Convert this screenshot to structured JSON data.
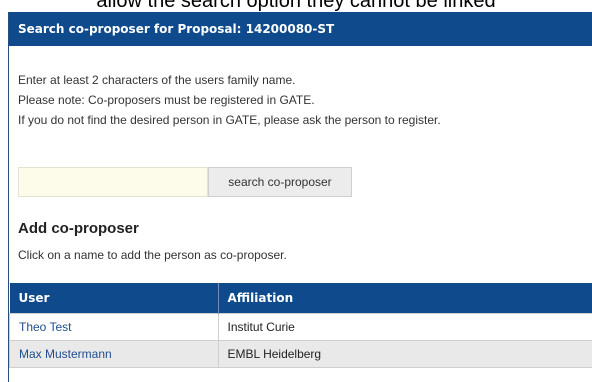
{
  "caption": "allow the search option they cannot be linked",
  "header": {
    "title": "Search co-proposer for Proposal: 14200080-ST"
  },
  "info": {
    "line1": "Enter at least 2 characters of the users family name.",
    "line2": "Please note: Co-proposers must be registered in GATE.",
    "line3": "If you do not find the desired person in GATE, please ask the person to register."
  },
  "search": {
    "value": "",
    "button_label": "search co-proposer"
  },
  "add_section": {
    "title": "Add co-proposer",
    "description": "Click on a name to add the person as co-proposer."
  },
  "table": {
    "columns": [
      "User",
      "Affiliation"
    ],
    "rows": [
      {
        "user": "Theo Test",
        "affiliation": "Institut Curie"
      },
      {
        "user": "Max Mustermann",
        "affiliation": "EMBL Heidelberg"
      }
    ]
  },
  "colors": {
    "header_bg": "#0e4a8c",
    "link": "#1f4e8c",
    "input_bg": "#fdfbea"
  }
}
